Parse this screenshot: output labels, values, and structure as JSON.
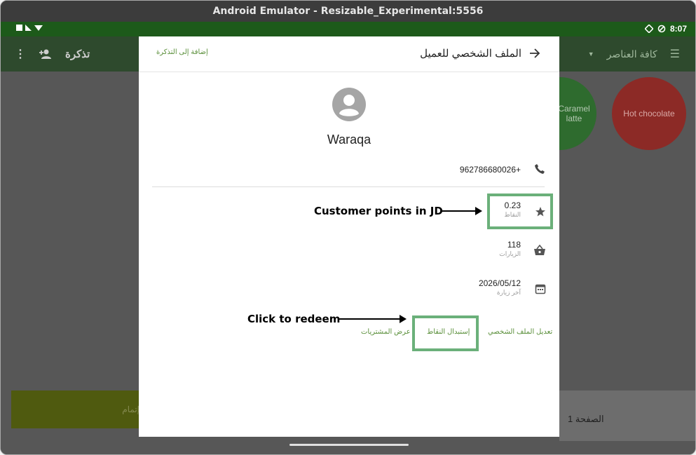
{
  "window": {
    "title": "Android Emulator - Resizable_Experimental:5556"
  },
  "status_bar": {
    "time": "8:07"
  },
  "app_bar": {
    "ticket_label": "تذكرة",
    "category_label": "كافة العناصر"
  },
  "background": {
    "products": [
      "Caramel latte",
      "Hot chocolate"
    ],
    "pay_button": "إتمام",
    "page_label": "الصفحة 1"
  },
  "dialog": {
    "title": "الملف الشخصي للعميل",
    "add_to_ticket": "إضافة إلى التذكرة",
    "customer_name": "Waraqa",
    "phone": "962786680026+",
    "points": {
      "value": "0.23",
      "label": "النقاط"
    },
    "visits": {
      "value": "118",
      "label": "الزيارات"
    },
    "last_visit": {
      "value": "2026/05/12",
      "label": "آخر زيارة"
    },
    "actions": {
      "edit_profile": "تعديل الملف الشخصي",
      "redeem_points": "إستبدال النقاط",
      "view_purchases": "عرض المشتريات"
    }
  },
  "annotations": {
    "points_note": "Customer points in JD",
    "redeem_note": "Click to redeem",
    "highlight_color": "#6bb07a"
  }
}
